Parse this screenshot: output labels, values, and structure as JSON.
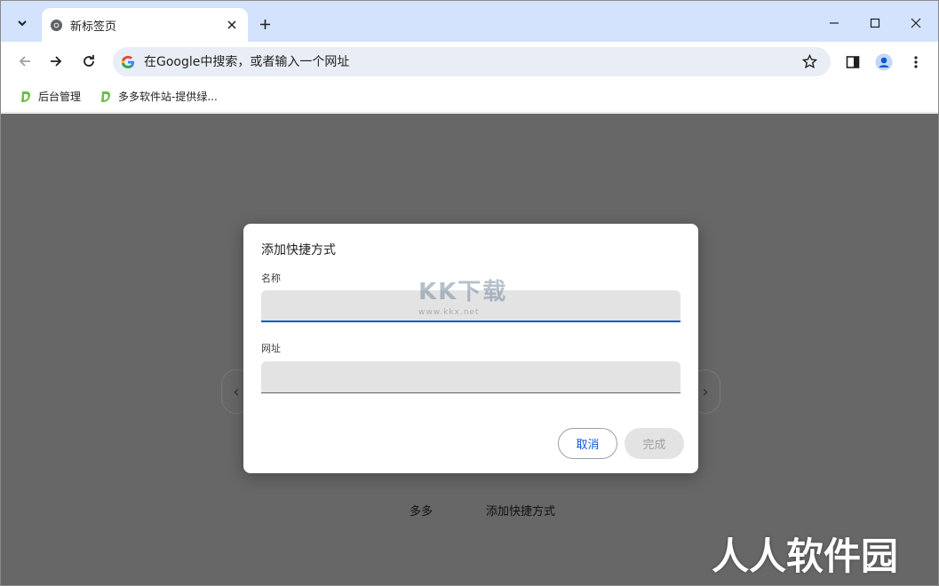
{
  "tabs": [
    {
      "label": "新标签页"
    }
  ],
  "toolbar": {
    "omnibox_placeholder": "在Google中搜索，或者输入一个网址"
  },
  "bookmarks": [
    {
      "label": "后台管理"
    },
    {
      "label": "多多软件站-提供绿..."
    }
  ],
  "ntp": {
    "tiles": [
      {
        "label": "多多"
      },
      {
        "label": "添加快捷方式"
      }
    ]
  },
  "dialog": {
    "title": "添加快捷方式",
    "name_label": "名称",
    "name_value": "",
    "url_label": "网址",
    "url_value": "",
    "cancel_label": "取消",
    "done_label": "完成"
  },
  "watermarks": {
    "center_text": "KK下载",
    "center_url": "www.kkx.net",
    "corner_text": "人人软件园"
  },
  "colors": {
    "tabstrip": "#d3e3fd",
    "omnibox": "#e9eef6",
    "accent": "#0b57d0"
  }
}
